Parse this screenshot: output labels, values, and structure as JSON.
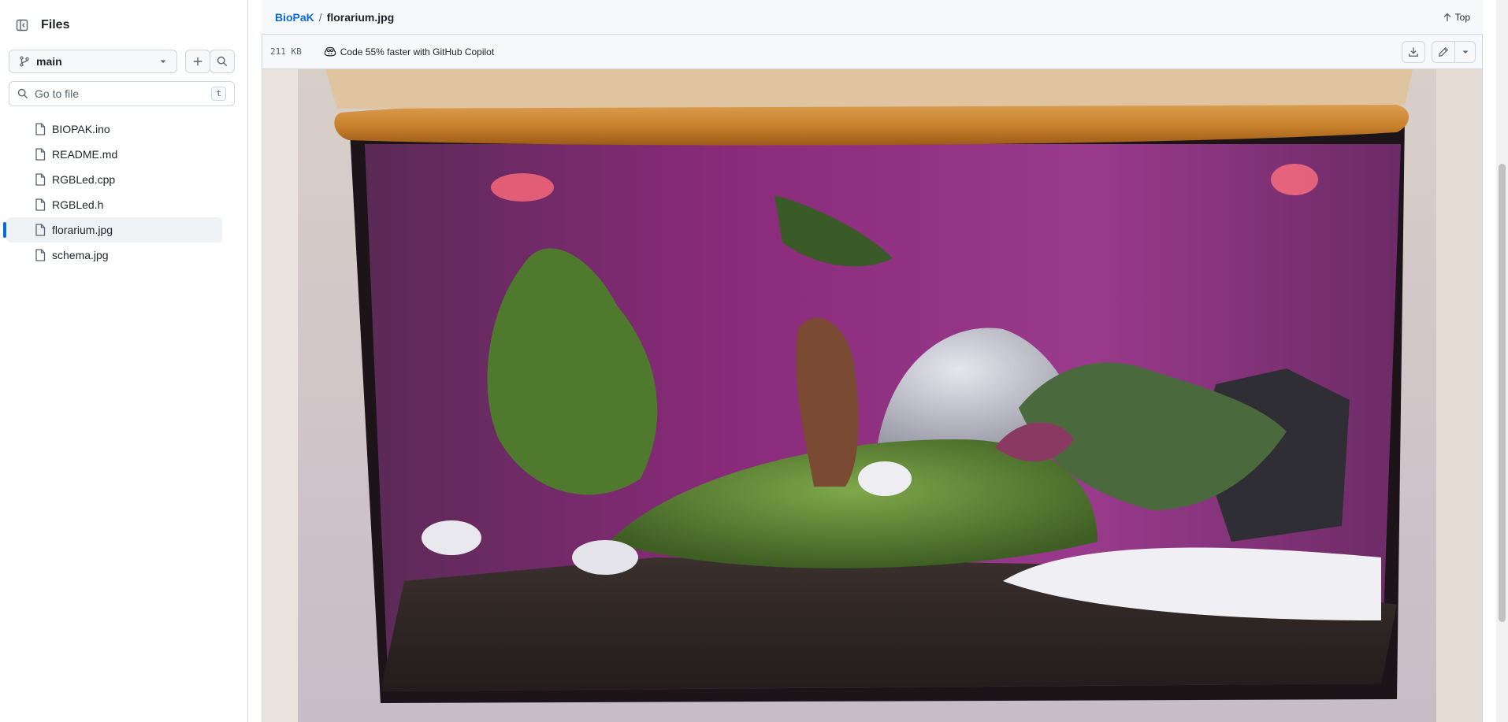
{
  "sidebar": {
    "title": "Files",
    "branch": "main",
    "goto_placeholder": "Go to file",
    "goto_shortcut": "t",
    "files": [
      {
        "name": "BIOPAK.ino",
        "active": false
      },
      {
        "name": "README.md",
        "active": false
      },
      {
        "name": "RGBLed.cpp",
        "active": false
      },
      {
        "name": "RGBLed.h",
        "active": false
      },
      {
        "name": "florarium.jpg",
        "active": true
      },
      {
        "name": "schema.jpg",
        "active": false
      }
    ]
  },
  "breadcrumb": {
    "repo": "BioPaK",
    "separator": "/",
    "file": "florarium.jpg"
  },
  "top_link": "Top",
  "file_info": {
    "size": "211 KB",
    "copilot_text": "Code 55% faster with GitHub Copilot"
  },
  "colors": {
    "accent": "#0969da",
    "border": "#d0d7de",
    "header_bg": "#f6f8fa"
  },
  "icons": {
    "sidebar_toggle": "sidebar-collapse-icon",
    "branch": "git-branch-icon",
    "add": "plus-icon",
    "search": "search-icon",
    "file": "file-icon",
    "top": "arrow-up-icon",
    "copilot": "copilot-icon",
    "download": "download-icon",
    "edit": "pencil-icon",
    "caret": "triangle-down-icon"
  }
}
